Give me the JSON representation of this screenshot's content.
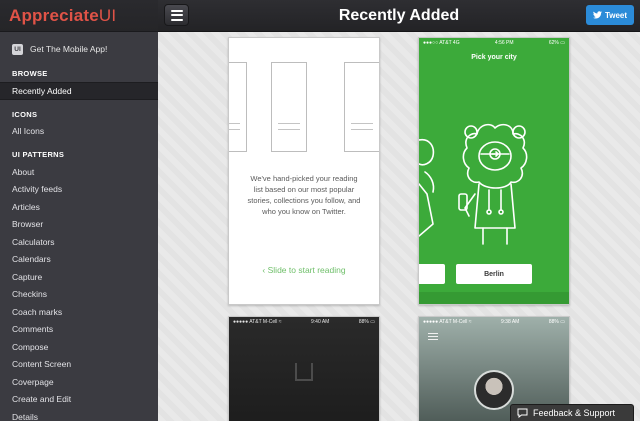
{
  "app": {
    "logo_part1": "Appreciate",
    "logo_part2": "UI",
    "accent": "#e05347"
  },
  "sidebar": {
    "mobile_icon_text": "UI",
    "mobile_label": "Get The Mobile App!",
    "sections": {
      "browse": "BROWSE",
      "icons": "ICONS",
      "patterns": "UI PATTERNS"
    },
    "browse_items": [
      "Recently Added"
    ],
    "icons_items": [
      "All Icons"
    ],
    "pattern_items": [
      "About",
      "Activity feeds",
      "Articles",
      "Browser",
      "Calculators",
      "Calendars",
      "Capture",
      "Checkins",
      "Coach marks",
      "Comments",
      "Compose",
      "Content Screen",
      "Coverpage",
      "Create and Edit",
      "Details"
    ]
  },
  "header": {
    "title": "Recently Added",
    "tweet_label": "Tweet",
    "tweet_icon": "twitter-bird-icon"
  },
  "cards": {
    "reading": {
      "text": "We've hand-picked your reading list based on our most popular stories, collections you follow, and who you know on Twitter.",
      "cta": "Slide to start reading"
    },
    "city": {
      "status_left": "●●●○○ AT&T  4G",
      "status_time": "4:56 PM",
      "status_right": "62% ▭",
      "pick_label": "Pick your city",
      "city_value": "Berlin",
      "color": "#3caa3a"
    },
    "dark": {
      "status_left": "●●●●● AT&T M-Cell ≈",
      "status_time": "9:40 AM",
      "status_right": "88% ▭"
    },
    "profile": {
      "status_left": "●●●●● AT&T M-Cell ≈",
      "status_time": "9:38 AM",
      "status_right": "88% ▭"
    }
  },
  "feedback": {
    "label": "Feedback & Support"
  }
}
